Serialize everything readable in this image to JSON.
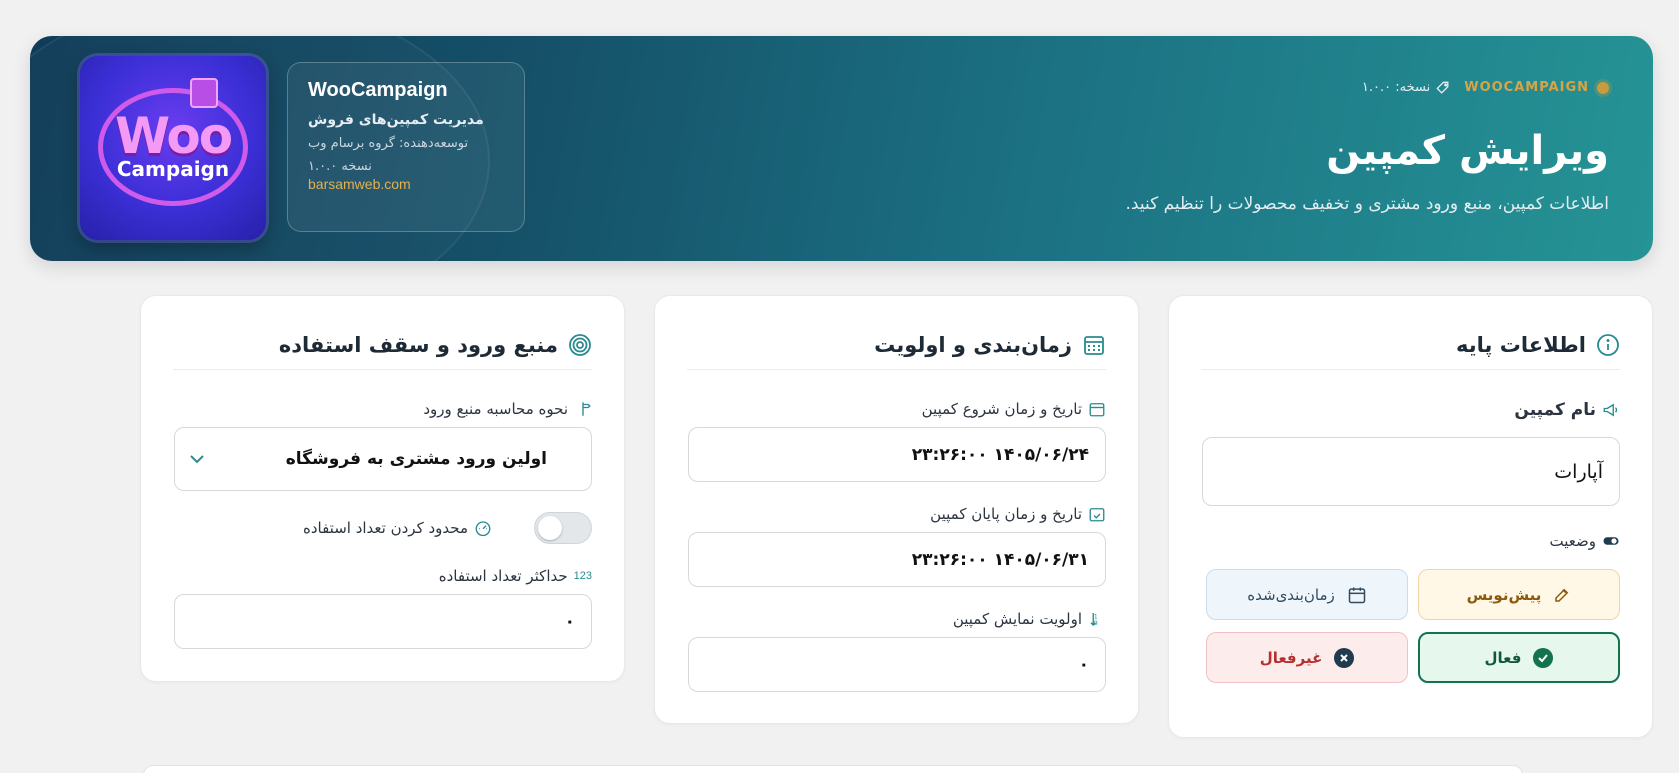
{
  "header": {
    "brand": "WOOCAMPAIGN",
    "version_label": "نسخه: ۱.۰.۰",
    "title": "ویرایش کمپین",
    "subtitle": "اطلاعات کمپین، منبع ورود مشتری و تخفیف محصولات را تنظیم کنید.",
    "accent_color": "#d6a548"
  },
  "plugin": {
    "logo_text_top": "Woo",
    "logo_text_bottom": "Campaign",
    "name": "WooCampaign",
    "title": "مدیریت کمپین‌های فروش",
    "developer": "توسعه‌دهنده: گروه برسام وب",
    "version": "نسخه ۱.۰.۰",
    "website": "barsamweb.com"
  },
  "basic_info": {
    "title": "اطلاعات پایه",
    "icon": "info-icon",
    "name_label": "نام کمپین",
    "name_value": "آپارات",
    "status_label": "وضعیت",
    "statuses": {
      "draft": "پیش‌نویس",
      "scheduled": "زمان‌بندی‌شده",
      "active": "فعال",
      "inactive": "غیرفعال"
    },
    "selected_status": "active"
  },
  "scheduling": {
    "title": "زمان‌بندی و اولویت",
    "icon": "calendar-icon",
    "start_label": "تاریخ و زمان شروع کمپین",
    "start_value": "۱۴۰۵/۰۶/۲۴ ۲۳:۲۶:۰۰",
    "end_label": "تاریخ و زمان پایان کمپین",
    "end_value": "۱۴۰۵/۰۶/۳۱ ۲۳:۲۶:۰۰",
    "priority_label": "اولویت نمایش کمپین",
    "priority_value": "۰"
  },
  "source": {
    "title": "منبع ورود و سقف استفاده",
    "icon": "target-icon",
    "calc_label": "نحوه محاسبه منبع ورود",
    "calc_value": "اولین ورود مشتری به فروشگاه",
    "limit_label": "محدود کردن تعداد استفاده",
    "limit_enabled": false,
    "max_label": "حداکثر تعداد استفاده",
    "max_icon_text": "123",
    "max_value": "۰"
  }
}
